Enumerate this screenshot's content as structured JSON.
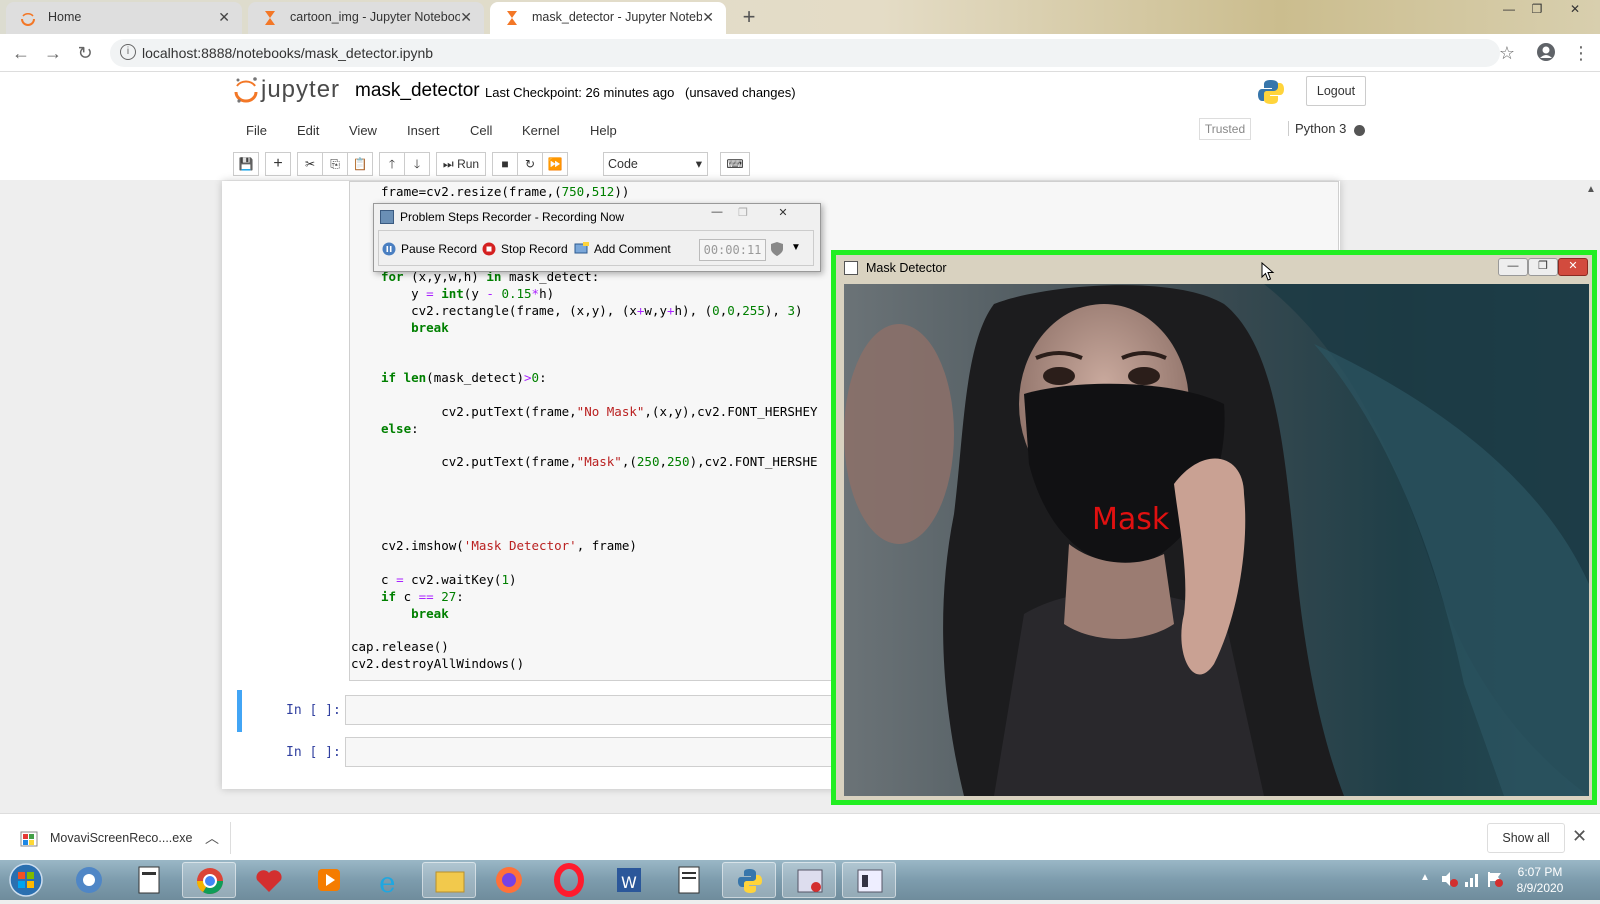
{
  "browser": {
    "tabs": [
      {
        "label": "Home",
        "active": false
      },
      {
        "label": "cartoon_img - Jupyter Notebook",
        "active": false
      },
      {
        "label": "mask_detector - Jupyter Noteboo",
        "active": true
      }
    ],
    "url": "localhost:8888/notebooks/mask_detector.ipynb"
  },
  "jupyter": {
    "logo_text": "jupyter",
    "notebook_name": "mask_detector",
    "checkpoint": "Last Checkpoint: 26 minutes ago",
    "unsaved": "(unsaved changes)",
    "logout": "Logout",
    "menu": [
      "File",
      "Edit",
      "View",
      "Insert",
      "Cell",
      "Kernel",
      "Help"
    ],
    "trusted": "Trusted",
    "kernel": "Python 3",
    "toolbar": {
      "run": "Run",
      "cell_type": "Code"
    },
    "prompts": [
      "In [ ]:",
      "In [ ]:"
    ]
  },
  "code_lines": [
    "frame=cv2.resize(frame,(750,512))",
    "for (x,y,w,h) in mask_detect:",
    "    y = int(y - 0.15*h)",
    "    cv2.rectangle(frame, (x,y), (x+w,y+h), (0,0,255), 3)",
    "    break",
    "if len(mask_detect)>0:",
    "        cv2.putText(frame,\"No Mask\",(x,y),cv2.FONT_HERSHEY",
    "else:",
    "        cv2.putText(frame,\"Mask\",(250,250),cv2.FONT_HERSHE",
    "cv2.imshow('Mask Detector', frame)",
    "c = cv2.waitKey(1)",
    "if c == 27:",
    "    break",
    "cap.release()",
    "cv2.destroyAllWindows()"
  ],
  "psr": {
    "title": "Problem Steps Recorder - Recording Now",
    "pause": "Pause Record",
    "stop": "Stop Record",
    "comment": "Add Comment",
    "time": "00:00:11"
  },
  "mask_window": {
    "title": "Mask Detector",
    "label": "Mask",
    "border_color": "#22ee22",
    "label_color": "#e01010"
  },
  "downloads": {
    "file": "MovaviScreenReco....exe",
    "show_all": "Show all"
  },
  "taskbar": {
    "time": "6:07 PM",
    "date": "8/9/2020"
  }
}
